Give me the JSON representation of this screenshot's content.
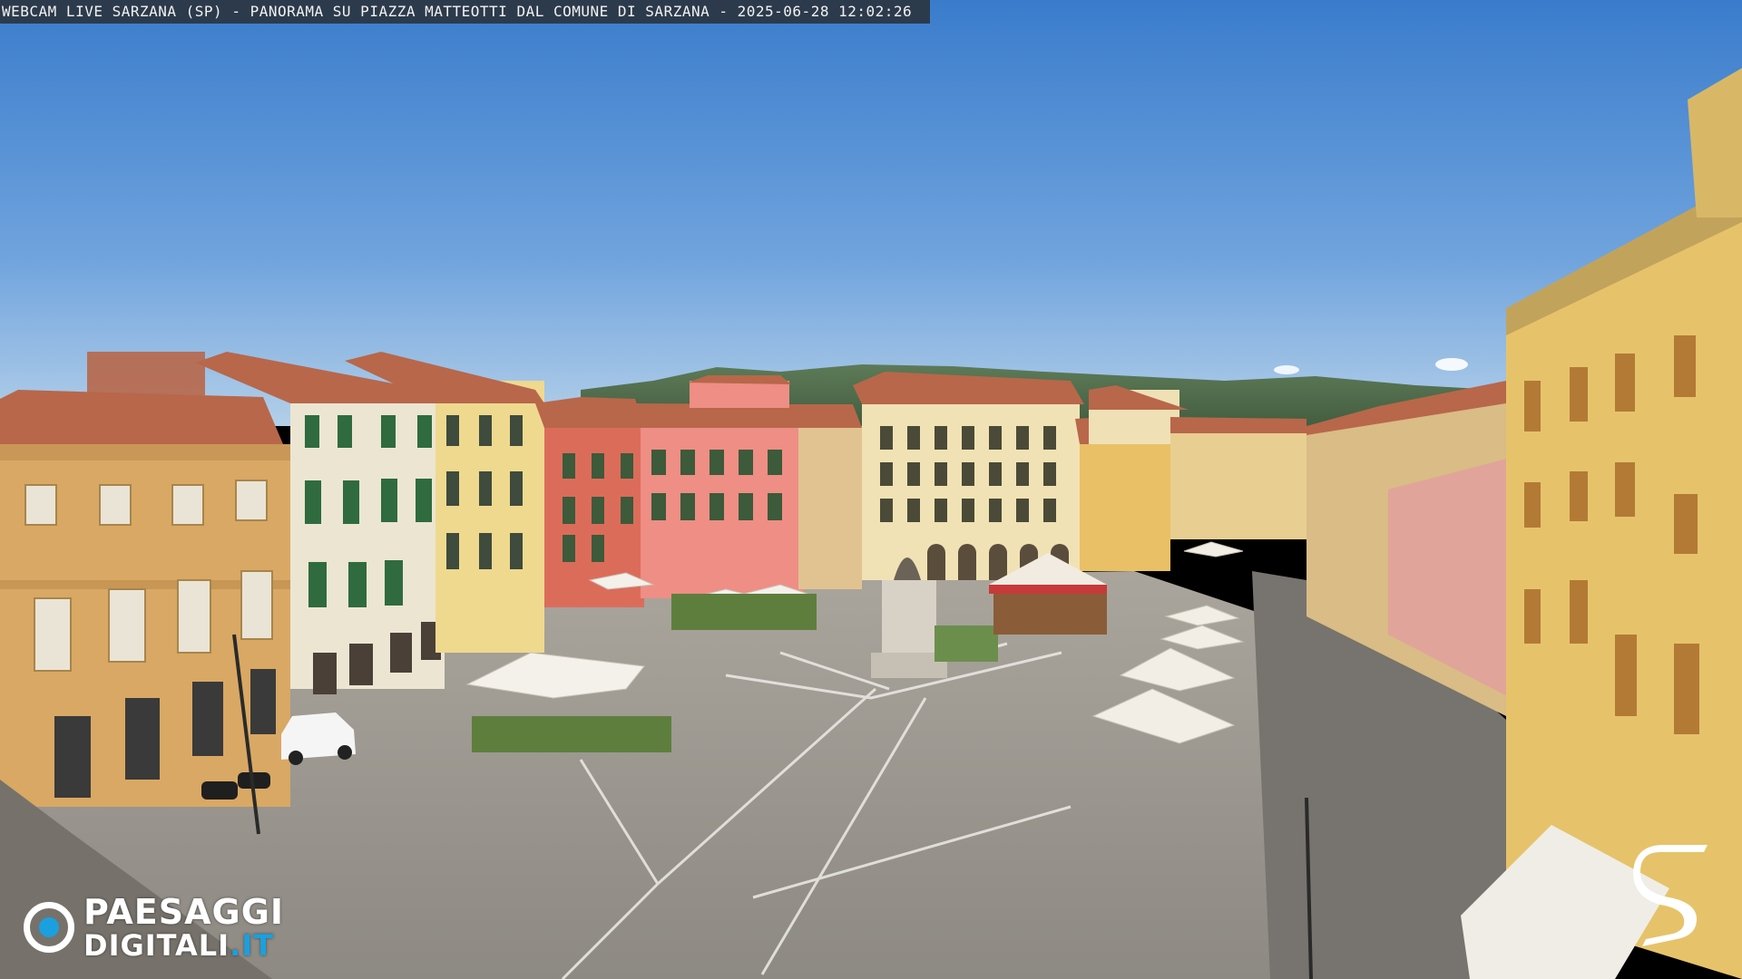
{
  "overlay": {
    "caption": "WEBCAM LIVE SARZANA (SP) - PANORAMA SU PIAZZA MATTEOTTI DAL COMUNE DI SARZANA - 2025-06-28  12:02:26"
  },
  "logo": {
    "line1": "PAESAGGI",
    "line2": "DIGITALI",
    "suffix": ".IT",
    "accent_color": "#1aa0df",
    "icon": "eye-lens-icon"
  },
  "corner_logo": {
    "icon": "letter-s-logo-icon"
  },
  "colors": {
    "sky_top": "#3b7fd0",
    "sky_bottom": "#a9c8e6",
    "pavement": "#9a968f",
    "roof": "#b8674a"
  }
}
